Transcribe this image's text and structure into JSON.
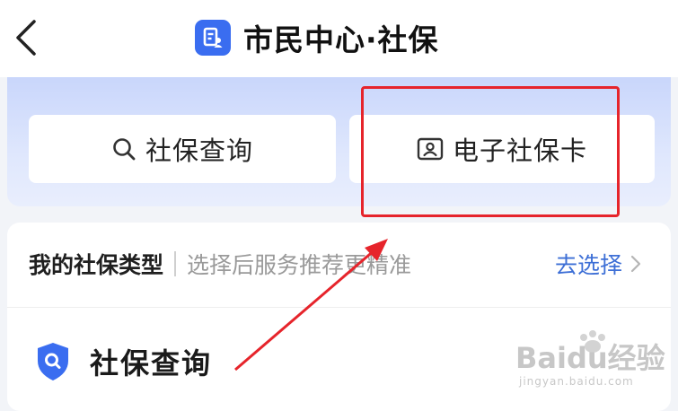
{
  "header": {
    "title": "市民中心·社保"
  },
  "quick_actions": [
    {
      "label": "社保查询",
      "icon": "search-icon"
    },
    {
      "label": "电子社保卡",
      "icon": "id-card-icon"
    }
  ],
  "insurance_type": {
    "label": "我的社保类型",
    "hint": "选择后服务推荐更精准",
    "action": "去选择"
  },
  "section": {
    "title": "社保查询",
    "icon": "shield-search-icon"
  },
  "watermark": {
    "brand": "Baidu经验",
    "url": "jingyan.baidu.com"
  },
  "colors": {
    "accent": "#3a6df0",
    "link": "#3d6fd6",
    "highlight": "#e6242b"
  }
}
